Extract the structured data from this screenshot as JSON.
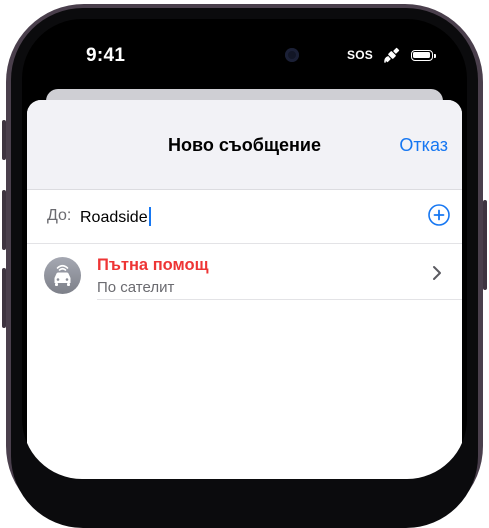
{
  "status_bar": {
    "time": "9:41",
    "sos": "SOS"
  },
  "sheet": {
    "title": "Ново съобщение",
    "cancel_label": "Отказ",
    "to_label": "До:",
    "to_value": "Roadside"
  },
  "results": [
    {
      "name": "Пътна помощ",
      "subtitle": "По сателит"
    }
  ],
  "colors": {
    "accent": "#1677f2",
    "result_name": "#ee3535",
    "sheet_header_bg": "#f2f2f6"
  }
}
